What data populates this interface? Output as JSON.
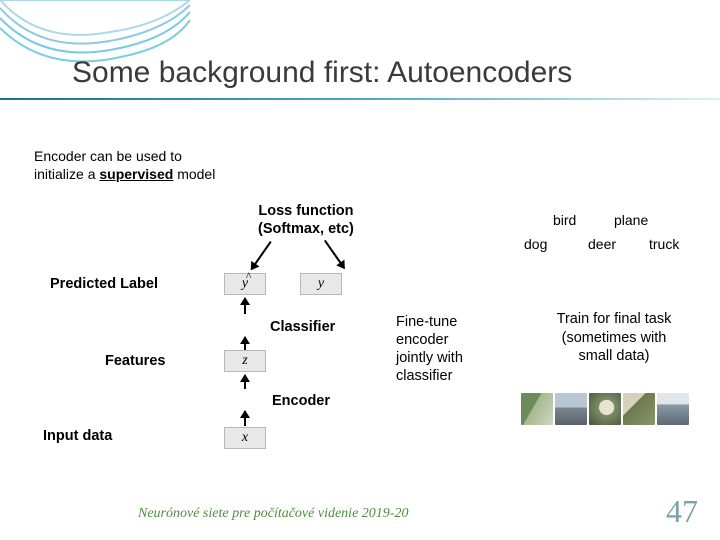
{
  "title": "Some background first: Autoencoders",
  "subhead_line1": "Encoder can be  used to",
  "subhead_line2_a": "initialize a  ",
  "subhead_line2_b": "supervised",
  "subhead_line2_c": " model",
  "lossfn_line1": "Loss function",
  "lossfn_line2": "(Softmax, etc)",
  "class_labels": {
    "bird": "bird",
    "plane": "plane",
    "dog": "dog",
    "deer": "deer",
    "truck": "truck"
  },
  "predicted_label": "Predicted Label",
  "classifier": "Classifier",
  "features": "Features",
  "encoder": "Encoder",
  "input_data": "Input data",
  "vars": {
    "yhat": "y",
    "y": "y",
    "z": "z",
    "x": "x"
  },
  "finetune_l1": "Fine-tune",
  "finetune_l2": "encoder",
  "finetune_l3": "jointly with",
  "finetune_l4": "classifier",
  "trainfor_l1": "Train for final task",
  "trainfor_l2": "(sometimes with",
  "trainfor_l3": "small data)",
  "footer": "Neurónové siete pre počítačové videnie 2019-20",
  "slide_number": "47"
}
